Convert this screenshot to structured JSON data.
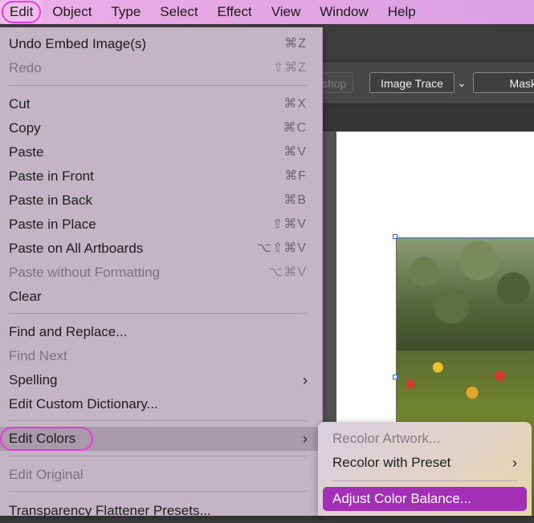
{
  "menubar": {
    "items": [
      "Edit",
      "Object",
      "Type",
      "Select",
      "Effect",
      "View",
      "Window",
      "Help"
    ]
  },
  "control_bar": {
    "photoshop_label": "shop",
    "image_trace_label": "Image Trace",
    "dropdown_icon": "chevron-down-icon",
    "mask_label": "Mask"
  },
  "edit_menu": {
    "items": [
      {
        "label": "Undo Embed Image(s)",
        "shortcut": "⌘Z",
        "enabled": true
      },
      {
        "label": "Redo",
        "shortcut": "⇧⌘Z",
        "enabled": false
      },
      {
        "label": "Cut",
        "shortcut": "⌘X",
        "enabled": true
      },
      {
        "label": "Copy",
        "shortcut": "⌘C",
        "enabled": true
      },
      {
        "label": "Paste",
        "shortcut": "⌘V",
        "enabled": true
      },
      {
        "label": "Paste in Front",
        "shortcut": "⌘F",
        "enabled": true
      },
      {
        "label": "Paste in Back",
        "shortcut": "⌘B",
        "enabled": true
      },
      {
        "label": "Paste in Place",
        "shortcut": "⇧⌘V",
        "enabled": true
      },
      {
        "label": "Paste on All Artboards",
        "shortcut": "⌥⇧⌘V",
        "enabled": true
      },
      {
        "label": "Paste without Formatting",
        "shortcut": "⌥⌘V",
        "enabled": false
      },
      {
        "label": "Clear",
        "shortcut": "",
        "enabled": true
      },
      {
        "label": "Find and Replace...",
        "shortcut": "",
        "enabled": true
      },
      {
        "label": "Find Next",
        "shortcut": "",
        "enabled": false
      },
      {
        "label": "Spelling",
        "shortcut": "",
        "enabled": true,
        "submenu": true
      },
      {
        "label": "Edit Custom Dictionary...",
        "shortcut": "",
        "enabled": true
      },
      {
        "label": "Edit Colors",
        "shortcut": "",
        "enabled": true,
        "submenu": true,
        "highlighted": true
      },
      {
        "label": "Edit Original",
        "shortcut": "",
        "enabled": false
      },
      {
        "label": "Transparency Flattener Presets...",
        "shortcut": "",
        "enabled": true
      }
    ]
  },
  "edit_colors_submenu": {
    "items": [
      {
        "label": "Recolor Artwork...",
        "enabled": false
      },
      {
        "label": "Recolor with Preset",
        "enabled": true,
        "submenu": true
      },
      {
        "label": "Adjust Color Balance...",
        "enabled": true,
        "selected": true
      }
    ]
  },
  "icons": {
    "submenu_arrow": "chevron-right-icon"
  }
}
